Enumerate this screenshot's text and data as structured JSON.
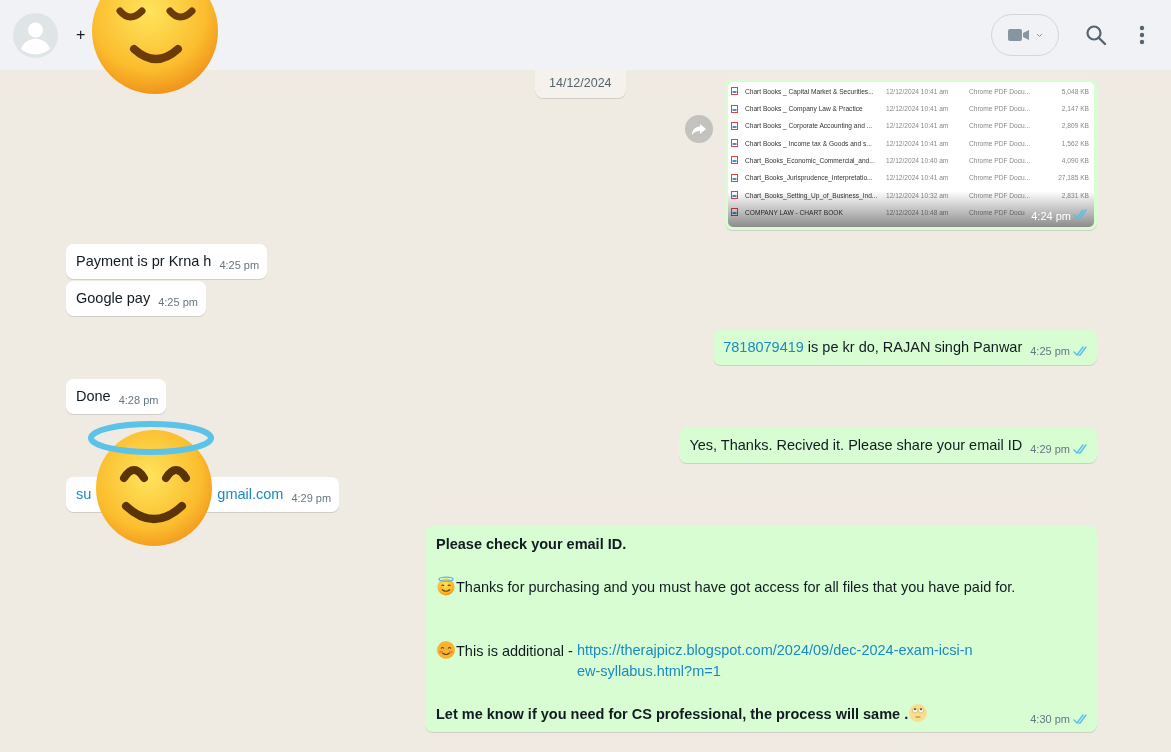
{
  "header": {
    "contact_name": "+"
  },
  "date_chip": "14/12/2024",
  "messages": [
    {
      "kind": "image",
      "outgoing": true,
      "time": "4:24 pm",
      "read": true,
      "files": [
        {
          "name": "Chart Books _ Capital Market & Securities...",
          "modified": "12/12/2024 10:41 am",
          "type": "Chrome PDF Docu...",
          "size": "5,048 KB"
        },
        {
          "name": "Chart Books _ Company Law & Practice",
          "modified": "12/12/2024 10:41 am",
          "type": "Chrome PDF Docu...",
          "size": "2,147 KB"
        },
        {
          "name": "Chart Books _ Corporate Accounting and ...",
          "modified": "12/12/2024 10:41 am",
          "type": "Chrome PDF Docu...",
          "size": "2,809 KB"
        },
        {
          "name": "Chart Books _ Income tax  & Goods and s...",
          "modified": "12/12/2024 10:41 am",
          "type": "Chrome PDF Docu...",
          "size": "1,562 KB"
        },
        {
          "name": "Chart_Books_Economic_Commercial_and...",
          "modified": "12/12/2024 10:40 am",
          "type": "Chrome PDF Docu...",
          "size": "4,090 KB"
        },
        {
          "name": "Chart_Books_Jurisprudence_Interpretatio...",
          "modified": "12/12/2024 10:41 am",
          "type": "Chrome PDF Docu...",
          "size": "27,185 KB"
        },
        {
          "name": "Chart_Books_Setting_Up_of_Business_Ind...",
          "modified": "12/12/2024 10:32 am",
          "type": "Chrome PDF Docu...",
          "size": "2,831 KB"
        },
        {
          "name": "COMPANY LAW - CHART BOOK",
          "modified": "12/12/2024 10:48 am",
          "type": "Chrome PDF Docu"
        }
      ]
    },
    {
      "kind": "text",
      "outgoing": false,
      "text": "Payment is pr Krna h",
      "time": "4:25 pm"
    },
    {
      "kind": "text",
      "outgoing": false,
      "text": "Google pay",
      "time": "4:25 pm"
    },
    {
      "kind": "phone",
      "outgoing": true,
      "link": "7818079419",
      "text": " is pe kr do, RAJAN singh Panwar",
      "time": "4:25 pm",
      "read": true
    },
    {
      "kind": "text",
      "outgoing": false,
      "text": "Done",
      "time": "4:28 pm"
    },
    {
      "kind": "text",
      "outgoing": true,
      "text": "Yes, Thanks. Recived it. Please share your email ID",
      "time": "4:29 pm",
      "read": true
    },
    {
      "kind": "email",
      "outgoing": false,
      "parts": [
        "su",
        "gmail.com"
      ],
      "time": "4:29 pm"
    },
    {
      "kind": "rich",
      "outgoing": true,
      "time": "4:30 pm",
      "read": true,
      "paragraphs": [
        {
          "kind": "bold",
          "text": "Please check your email ID."
        },
        {
          "kind": "halo-start",
          "text": "Thanks for purchasing and you must have got access for all files that you have paid for."
        },
        {
          "kind": "blush-start",
          "text": "This is additional - ",
          "link": "https://therajpicz.blogspot.com/2024/09/dec-2024-exam-icsi-new-syllabus.html?m=1"
        },
        {
          "kind": "bold-eyes-end",
          "text": "Let me know if you need for CS professional, the process will same ."
        }
      ]
    }
  ],
  "stickers": [
    {
      "kind": "relieved"
    },
    {
      "kind": "halo"
    }
  ]
}
